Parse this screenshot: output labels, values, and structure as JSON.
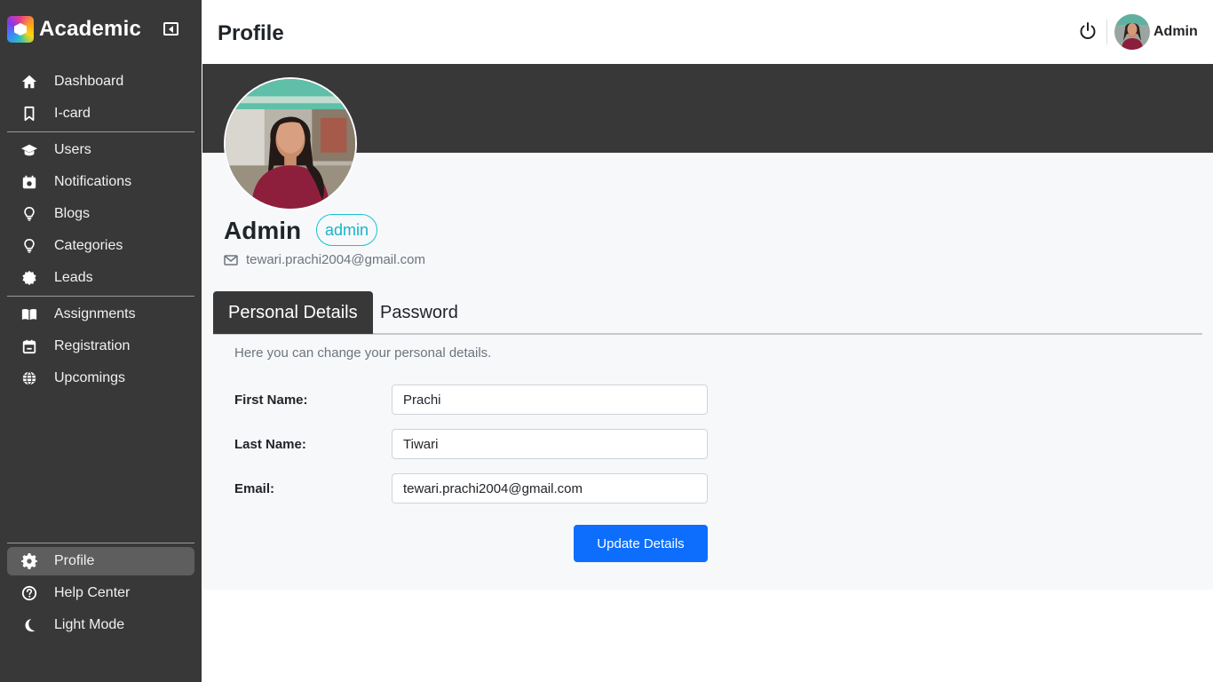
{
  "app": {
    "name": "Academic"
  },
  "sidebar": {
    "items": [
      {
        "label": "Dashboard",
        "icon": "home-icon"
      },
      {
        "label": "I-card",
        "icon": "bookmark-icon"
      },
      {
        "label": "Users",
        "icon": "graduation-cap-icon"
      },
      {
        "label": "Notifications",
        "icon": "calendar-icon"
      },
      {
        "label": "Blogs",
        "icon": "lightbulb-icon"
      },
      {
        "label": "Categories",
        "icon": "lightbulb-icon"
      },
      {
        "label": "Leads",
        "icon": "certificate-icon"
      },
      {
        "label": "Assignments",
        "icon": "book-open-icon"
      },
      {
        "label": "Registration",
        "icon": "calendar-minus-icon"
      },
      {
        "label": "Upcomings",
        "icon": "globe-icon"
      }
    ],
    "bottom_items": [
      {
        "label": "Profile",
        "icon": "gear-icon",
        "active": true
      },
      {
        "label": "Help Center",
        "icon": "question-circle-icon"
      },
      {
        "label": "Light Mode",
        "icon": "moon-icon"
      }
    ]
  },
  "header": {
    "title": "Profile",
    "username": "Admin"
  },
  "profile": {
    "name": "Admin",
    "role": "admin",
    "email": "tewari.prachi2004@gmail.com"
  },
  "tabs": [
    {
      "label": "Personal Details",
      "active": true
    },
    {
      "label": "Password",
      "active": false
    }
  ],
  "form": {
    "helper_text": "Here you can change your personal details.",
    "first_name_label": "First Name:",
    "first_name_value": "Prachi",
    "last_name_label": "Last Name:",
    "last_name_value": "Tiwari",
    "email_label": "Email:",
    "email_value": "tewari.prachi2004@gmail.com",
    "submit_label": "Update Details"
  },
  "colors": {
    "sidebar_bg": "#383838",
    "accent_blue": "#0d6efd",
    "badge_cyan": "#17c1d8"
  }
}
